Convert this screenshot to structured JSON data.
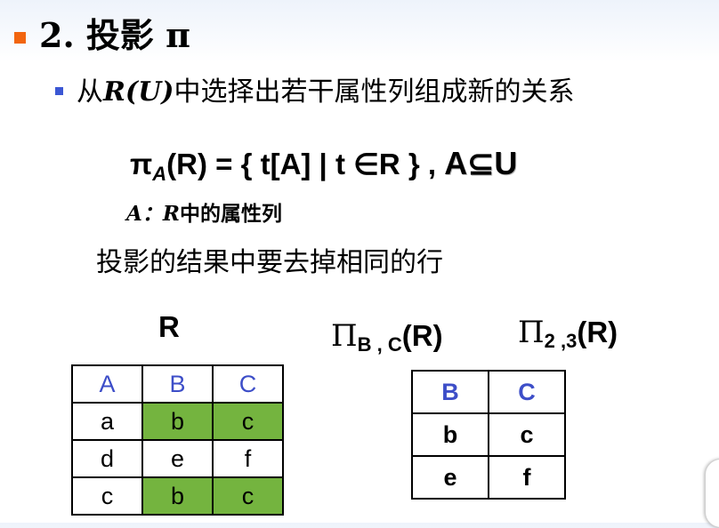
{
  "title": "2. 投影 π",
  "bullet": {
    "prefix": "从",
    "rel": "R(U)",
    "suffix": "中选择出若干属性列组成新的关系"
  },
  "formula": {
    "pi": "π",
    "sub": "A",
    "body": "(R) = { t[A] | t ∈R } ,",
    "subset": "A⊆U"
  },
  "note": {
    "a": "A：",
    "r": "R",
    "rest": "中的属性列"
  },
  "description": "投影的结果中要去掉相同的行",
  "relation_label": "R",
  "proj1": {
    "pi": "Π",
    "sub": "B , C",
    "rest": "(R)"
  },
  "proj2": {
    "pi": "Π",
    "sub": "2 ,3",
    "rest": "(R)"
  },
  "table_r": {
    "headers": [
      "A",
      "B",
      "C"
    ],
    "rows": [
      [
        "a",
        "b",
        "c"
      ],
      [
        "d",
        "e",
        "f"
      ],
      [
        "c",
        "b",
        "c"
      ]
    ],
    "highlight_color": "#74b43f"
  },
  "table_proj": {
    "headers": [
      "B",
      "C"
    ],
    "rows": [
      [
        "b",
        "c"
      ],
      [
        "e",
        "f"
      ]
    ]
  }
}
